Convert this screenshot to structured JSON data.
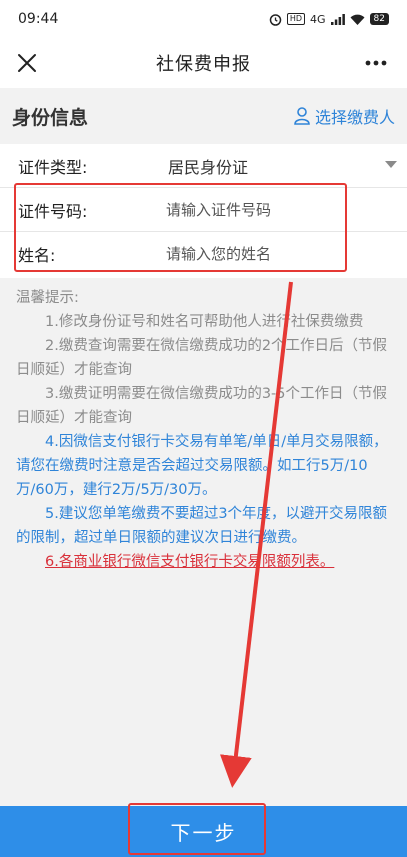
{
  "status_bar": {
    "time": "09:44",
    "network": "4G",
    "hd": "HD",
    "battery": "82"
  },
  "header": {
    "title": "社保费申报",
    "close_icon": "close-icon",
    "more_icon": "more-icon"
  },
  "section": {
    "title": "身份信息",
    "select_payer": "选择缴费人"
  },
  "form": {
    "id_type_label": "证件类型:",
    "id_type_value": "居民身份证",
    "id_number_label": "证件号码:",
    "id_number_placeholder": "请输入证件号码",
    "name_label": "姓名:",
    "name_placeholder": "请输入您的姓名"
  },
  "tips": {
    "title": "温馨提示:",
    "items": [
      "1.修改身份证号和姓名可帮助他人进行社保费缴费",
      "2.缴费查询需要在微信缴费成功的2个工作日后（节假日顺延）才能查询",
      "3.缴费证明需要在微信缴费成功的3-5个工作日（节假日顺延）才能查询",
      "4.因微信支付银行卡交易有单笔/单日/单月交易限额，请您在缴费时注意是否会超过交易限额。如工行5万/10万/60万，建行2万/5万/30万。",
      "5.建议您单笔缴费不要超过3个年度，以避开交易限额的限制，超过单日限额的建议次日进行缴费。",
      "6.各商业银行微信支付银行卡交易限额列表。"
    ]
  },
  "footer": {
    "next_label": "下一步"
  },
  "colors": {
    "accent": "#2e8ee8",
    "link": "#2f84d8",
    "annotation": "#e53935"
  }
}
